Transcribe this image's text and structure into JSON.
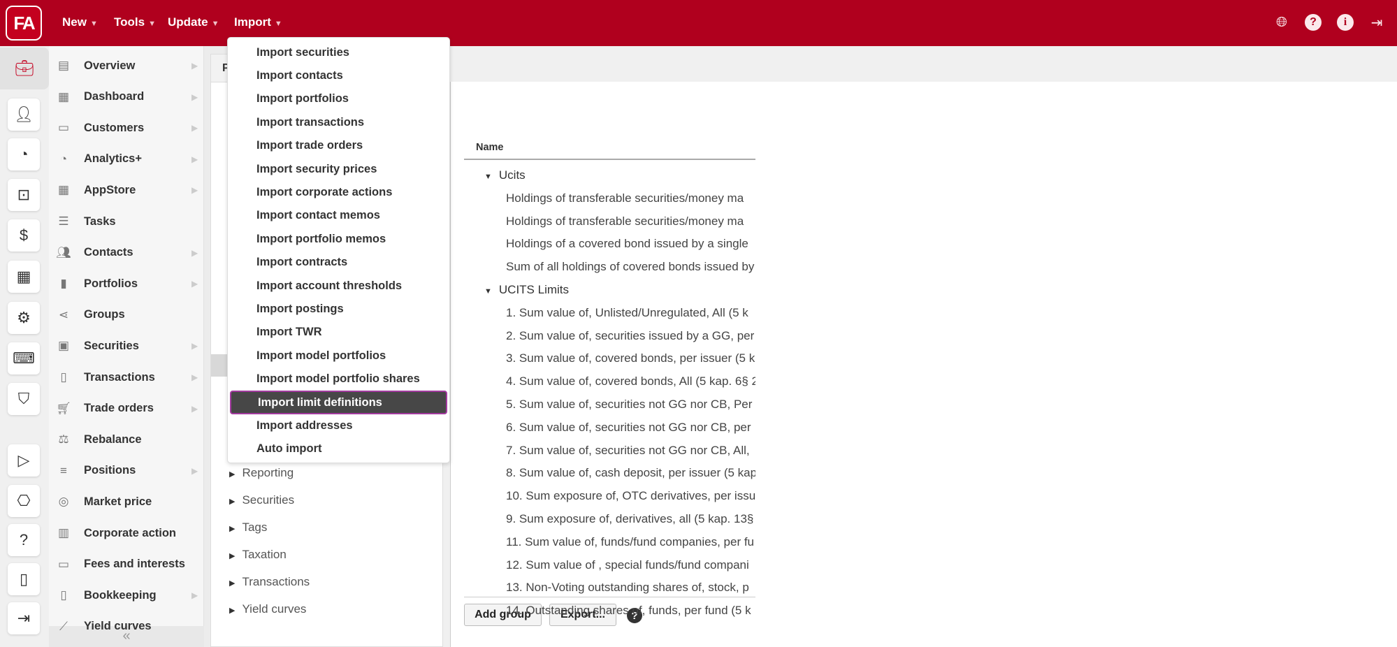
{
  "app": {
    "logo": "FA",
    "brand_color": "#b0001e"
  },
  "topbar": {
    "menus": [
      "New",
      "Tools",
      "Update",
      "Import"
    ],
    "icons": [
      "globe-icon",
      "help-icon",
      "info-icon",
      "logout-icon"
    ]
  },
  "rail": {
    "icons": [
      "briefcase-icon",
      "customer-money-icon",
      "analytics-icon",
      "money-network-icon",
      "hand-money-icon",
      "building-icon",
      "settings-sheet-icon",
      "code-laptop-icon",
      "shield-icon",
      "play-icon",
      "ticket-icon",
      "help-icon",
      "mobile-icon",
      "logout-icon"
    ]
  },
  "nav": {
    "items": [
      {
        "label": "Overview",
        "icon": "overview-icon",
        "arrow": true
      },
      {
        "label": "Dashboard",
        "icon": "grid-icon",
        "arrow": true
      },
      {
        "label": "Customers",
        "icon": "id-card-icon",
        "arrow": true
      },
      {
        "label": "Analytics+",
        "icon": "analytics-icon",
        "arrow": true
      },
      {
        "label": "AppStore",
        "icon": "apps-icon",
        "arrow": true
      },
      {
        "label": "Tasks",
        "icon": "tasks-icon",
        "arrow": false
      },
      {
        "label": "Contacts",
        "icon": "people-icon",
        "arrow": true
      },
      {
        "label": "Portfolios",
        "icon": "portfolio-icon",
        "arrow": true
      },
      {
        "label": "Groups",
        "icon": "share-icon",
        "arrow": false
      },
      {
        "label": "Securities",
        "icon": "securities-icon",
        "arrow": true
      },
      {
        "label": "Transactions",
        "icon": "document-icon",
        "arrow": true
      },
      {
        "label": "Trade orders",
        "icon": "cart-icon",
        "arrow": true
      },
      {
        "label": "Rebalance",
        "icon": "scale-icon",
        "arrow": false
      },
      {
        "label": "Positions",
        "icon": "list-icon",
        "arrow": true
      },
      {
        "label": "Market price",
        "icon": "coins-icon",
        "arrow": false
      },
      {
        "label": "Corporate action",
        "icon": "corporate-icon",
        "arrow": false
      },
      {
        "label": "Fees and interests",
        "icon": "fees-icon",
        "arrow": false
      },
      {
        "label": "Bookkeeping",
        "icon": "book-icon",
        "arrow": true
      },
      {
        "label": "Yield curves",
        "icon": "chart-icon",
        "arrow": false
      }
    ],
    "collapse": "«"
  },
  "left_panel": {
    "tab": "P",
    "tree": [
      "Reporting",
      "Securities",
      "Tags",
      "Taxation",
      "Transactions",
      "Yield curves"
    ]
  },
  "main": {
    "column_header": "Name",
    "groups": [
      {
        "label": "Ucits",
        "children": [
          "Holdings of transferable securities/money ma",
          "Holdings of transferable securities/money ma",
          "Holdings of a covered bond issued by a single",
          "Sum of all holdings of covered bonds issued by"
        ]
      },
      {
        "label": "UCITS Limits",
        "children": [
          "1. Sum value of, Unlisted/Unregulated, All (5 k",
          "2. Sum value of, securities issued by a GG, per",
          "3. Sum value of, covered bonds, per issuer (5 k",
          "4. Sum value of, covered bonds, All (5 kap. 6§ 2",
          "5. Sum value of, securities not GG nor CB, Per",
          "6. Sum value of, securities not GG nor CB, per",
          "7. Sum value of, securities not GG nor CB, All,",
          "8. Sum value of, cash deposit, per issuer (5 kap",
          "10. Sum exposure of, OTC derivatives, per issu",
          "9. Sum exposure of, derivatives, all (5 kap. 13§",
          "11. Sum value of, funds/fund companies, per fu",
          "12. Sum value of , special funds/fund compani",
          "13. Non-Voting outstanding shares of, stock, p",
          "14. Outstanding shares of, funds, per fund (5 k"
        ]
      }
    ],
    "buttons": {
      "add_group": "Add group",
      "export": "Export..."
    },
    "help": "?"
  },
  "dropdown": {
    "selected": "Import limit definitions",
    "items": [
      "Import securities",
      "Import contacts",
      "Import portfolios",
      "Import transactions",
      "Import trade orders",
      "Import security prices",
      "Import corporate actions",
      "Import contact memos",
      "Import portfolio memos",
      "Import contracts",
      "Import account thresholds",
      "Import postings",
      "Import TWR",
      "Import model portfolios",
      "Import model portfolio shares",
      "Import limit definitions",
      "Import addresses",
      "Auto import"
    ]
  }
}
